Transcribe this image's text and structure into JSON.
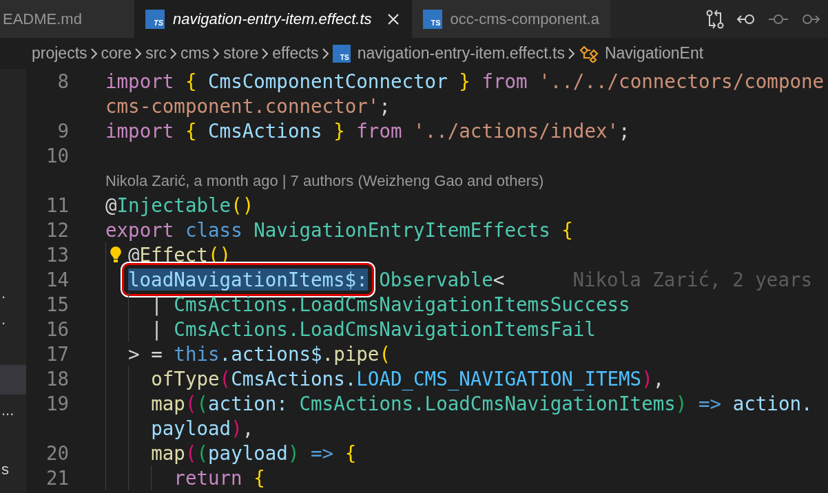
{
  "tabs": [
    {
      "label": "EADME.md",
      "selected": false
    },
    {
      "label": "navigation-entry-item.effect.ts",
      "icon_text": "TS",
      "selected": true,
      "closable": true
    },
    {
      "label": "occ-cms-component.a",
      "icon_text": "TS",
      "selected": false
    }
  ],
  "editor_actions": [
    {
      "kind": "compare",
      "disabled": false
    },
    {
      "kind": "previous",
      "disabled": false
    },
    {
      "kind": "current",
      "disabled": true
    },
    {
      "kind": "next",
      "disabled": true
    }
  ],
  "breadcrumbs": [
    {
      "label": "projects"
    },
    {
      "label": "core"
    },
    {
      "label": "src"
    },
    {
      "label": "cms"
    },
    {
      "label": "store"
    },
    {
      "label": "effects"
    },
    {
      "label": "navigation-entry-item.effect.ts",
      "icon_text": "TS"
    },
    {
      "label": "NavigationEnt",
      "kind": "symbol"
    }
  ],
  "sidebar_fragments": [
    {
      "text": "."
    },
    {
      "text": "."
    },
    {
      "text": "..."
    },
    {
      "text": "s"
    }
  ],
  "lines": [
    {
      "kind": "code",
      "number": "8",
      "tokens": [
        {
          "kind": "kw",
          "text": "import "
        },
        {
          "kind": "b1",
          "text": "{ "
        },
        {
          "kind": "var",
          "text": "CmsComponentConnector "
        },
        {
          "kind": "b1",
          "text": "} "
        },
        {
          "kind": "kw",
          "text": "from "
        },
        {
          "kind": "str",
          "text": "'../../connectors/compone"
        }
      ]
    },
    {
      "kind": "code",
      "tokens": [
        {
          "kind": "str",
          "text": "cms-component.connector'"
        },
        {
          "kind": "pun",
          "text": ";"
        }
      ]
    },
    {
      "kind": "code",
      "number": "9",
      "tokens": [
        {
          "kind": "kw",
          "text": "import "
        },
        {
          "kind": "b1",
          "text": "{ "
        },
        {
          "kind": "var",
          "text": "CmsActions "
        },
        {
          "kind": "b1",
          "text": "} "
        },
        {
          "kind": "kw",
          "text": "from "
        },
        {
          "kind": "str",
          "text": "'../actions/index'"
        },
        {
          "kind": "pun",
          "text": ";"
        }
      ]
    },
    {
      "kind": "code",
      "number": "10"
    },
    {
      "kind": "codelens",
      "text": "Nikola Zarić, a month ago | 7 authors (Weizheng Gao and others)"
    },
    {
      "kind": "code",
      "number": "11",
      "tokens": [
        {
          "kind": "pun",
          "text": "@"
        },
        {
          "kind": "ty",
          "text": "Injectable"
        },
        {
          "kind": "b1",
          "text": "()"
        }
      ]
    },
    {
      "kind": "code",
      "number": "12",
      "tokens": [
        {
          "kind": "kw",
          "text": "export "
        },
        {
          "kind": "st",
          "text": "class "
        },
        {
          "kind": "ty",
          "text": "NavigationEntryItemEffects "
        },
        {
          "kind": "b1",
          "text": "{"
        }
      ]
    },
    {
      "kind": "code",
      "number": "13",
      "lightbulb": true,
      "tokens": [
        {
          "kind": "pun",
          "text": "@"
        },
        {
          "kind": "fn",
          "text": "Effect"
        },
        {
          "kind": "b1",
          "text": "()"
        }
      ]
    },
    {
      "kind": "code",
      "number": "14",
      "highlight_box": true,
      "tokens": [
        {
          "kind": "var",
          "text": "loadNavigationItems$:",
          "selected": true
        },
        {
          "kind": "ty",
          "text": " Observable"
        },
        {
          "kind": "pun",
          "text": "<"
        }
      ],
      "blame": "Nikola Zarić, 2 years"
    },
    {
      "kind": "code",
      "number": "15",
      "tokens": [
        {
          "kind": "pun",
          "text": "    | "
        },
        {
          "kind": "ty",
          "text": "CmsActions.LoadCmsNavigationItemsSuccess"
        }
      ]
    },
    {
      "kind": "code",
      "number": "16",
      "tokens": [
        {
          "kind": "pun",
          "text": "    | "
        },
        {
          "kind": "ty",
          "text": "CmsActions.LoadCmsNavigationItemsFail"
        }
      ]
    },
    {
      "kind": "code",
      "number": "17",
      "tokens": [
        {
          "kind": "pun",
          "text": "  > = "
        },
        {
          "kind": "st",
          "text": "this"
        },
        {
          "kind": "var",
          "text": ".actions$"
        },
        {
          "kind": "fn",
          "text": ".pipe"
        },
        {
          "kind": "b1",
          "text": "("
        }
      ]
    },
    {
      "kind": "code",
      "number": "18",
      "tokens": [
        {
          "kind": "fn",
          "text": "    ofType"
        },
        {
          "kind": "b2",
          "text": "("
        },
        {
          "kind": "var",
          "text": "CmsActions."
        },
        {
          "kind": "const",
          "text": "LOAD_CMS_NAVIGATION_ITEMS"
        },
        {
          "kind": "b2",
          "text": ")"
        },
        {
          "kind": "pun",
          "text": ","
        }
      ]
    },
    {
      "kind": "code",
      "number": "19",
      "tokens": [
        {
          "kind": "fn",
          "text": "    map"
        },
        {
          "kind": "b2",
          "text": "("
        },
        {
          "kind": "b3",
          "text": "("
        },
        {
          "kind": "var",
          "text": "action: "
        },
        {
          "kind": "ty",
          "text": "CmsActions.LoadCmsNavigationItems"
        },
        {
          "kind": "b3",
          "text": ") "
        },
        {
          "kind": "st",
          "text": "=> "
        },
        {
          "kind": "var",
          "text": "action."
        }
      ]
    },
    {
      "kind": "code",
      "tokens": [
        {
          "kind": "var",
          "text": "    payload"
        },
        {
          "kind": "b2",
          "text": ")"
        },
        {
          "kind": "pun",
          "text": ","
        }
      ]
    },
    {
      "kind": "code",
      "number": "20",
      "tokens": [
        {
          "kind": "fn",
          "text": "    map"
        },
        {
          "kind": "b2",
          "text": "("
        },
        {
          "kind": "b3",
          "text": "("
        },
        {
          "kind": "var",
          "text": "payload"
        },
        {
          "kind": "b3",
          "text": ") "
        },
        {
          "kind": "st",
          "text": "=> "
        },
        {
          "kind": "b1",
          "text": "{"
        }
      ]
    },
    {
      "kind": "code",
      "number": "21",
      "tokens": [
        {
          "kind": "kw",
          "text": "      return "
        },
        {
          "kind": "b1",
          "text": "{"
        }
      ]
    }
  ]
}
